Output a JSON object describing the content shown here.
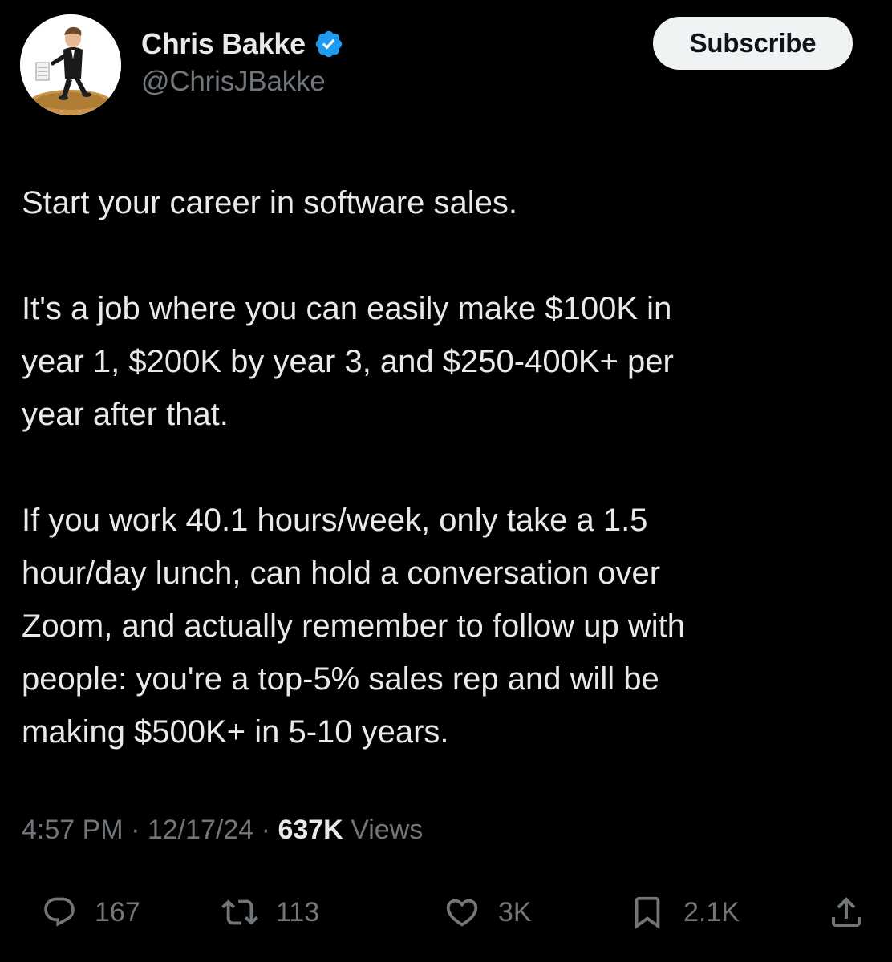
{
  "author": {
    "display_name": "Chris Bakke",
    "handle": "@ChrisJBakke",
    "verified": true,
    "verified_color": "#1d9bf0",
    "avatar_icon": "bitmoji-avatar-icon"
  },
  "header": {
    "subscribe_label": "Subscribe"
  },
  "tweet": {
    "paragraphs": [
      "Start your career in software sales.",
      "It's a job where you can easily make $100K in\nyear 1, $200K by year 3, and $250-400K+ per\nyear after that.",
      "If you work 40.1 hours/week, only take a 1.5\nhour/day lunch, can hold a conversation over\nZoom, and actually remember to follow up with\npeople: you're a top-5% sales rep and will be\nmaking $500K+ in 5-10 years."
    ]
  },
  "meta": {
    "time": "4:57 PM",
    "separator": "·",
    "date": "12/17/24",
    "views_count": "637K",
    "views_label": "Views"
  },
  "actions": {
    "replies": "167",
    "reposts": "113",
    "likes": "3K",
    "bookmarks": "2.1K"
  },
  "colors": {
    "background": "#000000",
    "primary_text": "#e7e9ea",
    "secondary_text": "#71767b",
    "button_bg": "#eff3f4"
  }
}
